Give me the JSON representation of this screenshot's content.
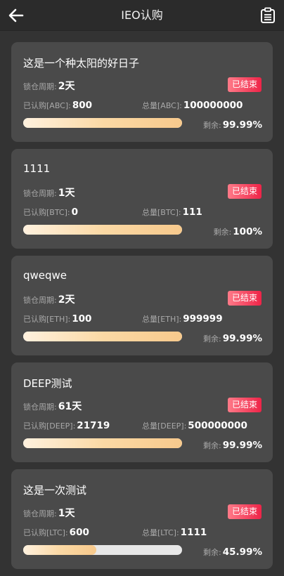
{
  "header": {
    "title": "IEO认购"
  },
  "labels": {
    "lock": "锁仓周期:",
    "remaining": "剩余:"
  },
  "cards": [
    {
      "name": "这是一个种太阳的好日子",
      "lock_period": "2天",
      "status": "已结束",
      "subscribed_label": "已认购[ABC]:",
      "subscribed": "800",
      "total_label": "总量[ABC]:",
      "total": "100000000",
      "remaining": "99.99%",
      "progress": 1.0
    },
    {
      "name": "1111",
      "lock_period": "1天",
      "status": "已结束",
      "subscribed_label": "已认购[BTC]:",
      "subscribed": "0",
      "total_label": "总量[BTC]:",
      "total": "111",
      "remaining": "100%",
      "progress": 1.0
    },
    {
      "name": "qweqwe",
      "lock_period": "2天",
      "status": "已结束",
      "subscribed_label": "已认购[ETH]:",
      "subscribed": "100",
      "total_label": "总量[ETH]:",
      "total": "999999",
      "remaining": "99.99%",
      "progress": 1.0
    },
    {
      "name": "DEEP测试",
      "lock_period": "61天",
      "status": "已结束",
      "subscribed_label": "已认购[DEEP]:",
      "subscribed": "21719",
      "total_label": "总量[DEEP]:",
      "total": "500000000",
      "remaining": "99.99%",
      "progress": 1.0
    },
    {
      "name": "这是一次测试",
      "lock_period": "1天",
      "status": "已结束",
      "subscribed_label": "已认购[LTC]:",
      "subscribed": "600",
      "total_label": "总量[LTC]:",
      "total": "1111",
      "remaining": "45.99%",
      "progress": 0.46
    }
  ],
  "icons": {
    "back": "back-arrow-icon",
    "records": "document-list-icon"
  }
}
